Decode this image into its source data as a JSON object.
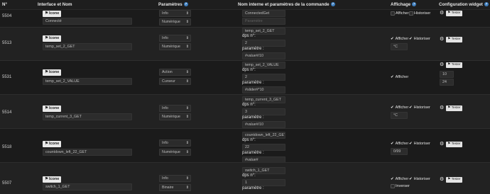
{
  "header": {
    "col_id": "N°",
    "col_interface": "Interface et Nom",
    "col_params": "Paramètres",
    "col_internal": "Nom interne et paramètres de la commande",
    "col_display": "Affichage",
    "col_widget": "Configuration widget",
    "help_glyph": "?"
  },
  "labels": {
    "icone": "Icone",
    "dps": "dps n°:",
    "parametre": "paramètre :",
    "afficher": "Afficher",
    "historiser": "Historiser",
    "inverser": "Inverser",
    "tester": "Tester",
    "parametre_placeholder": "Paramètre"
  },
  "rows": [
    {
      "id": "5504",
      "name": "Connecté",
      "type": "Info",
      "subtype": "Numérique",
      "internal": "ConnectedGet"
    },
    {
      "id": "5513",
      "name": "temp_set_2_GET",
      "type": "Info",
      "subtype": "Numérique",
      "internal": "temp_set_2_GET",
      "dps": "2",
      "param": "#value#/10",
      "unit": "°C"
    },
    {
      "id": "5531",
      "name": "temp_set_2_VALUE",
      "type": "Action",
      "subtype": "Curseur",
      "internal": "temp_set_2_VALUE",
      "dps": "2",
      "param": "#slider#*10",
      "min": "10",
      "max": "24"
    },
    {
      "id": "5514",
      "name": "temp_current_3_GET",
      "type": "Info",
      "subtype": "Numérique",
      "internal": "temp_current_3_GET",
      "dps": "3",
      "param": "#value#/10",
      "unit": "°C"
    },
    {
      "id": "5518",
      "name": "countdown_left_22_GET",
      "type": "Info",
      "subtype": "Numérique",
      "internal": "countdown_left_22_GET",
      "dps": "22",
      "param": "#value#",
      "unit": "0/99"
    },
    {
      "id": "5507",
      "name": "switch_1_GET",
      "type": "Info",
      "subtype": "Binaire",
      "internal": "switch_1_GET",
      "dps": "1",
      "param": ""
    }
  ],
  "icons": {
    "flag": "flag-icon",
    "gear": "gear-icon",
    "check": "checkmark-icon",
    "arrow": "dropdown-arrow-icon"
  }
}
